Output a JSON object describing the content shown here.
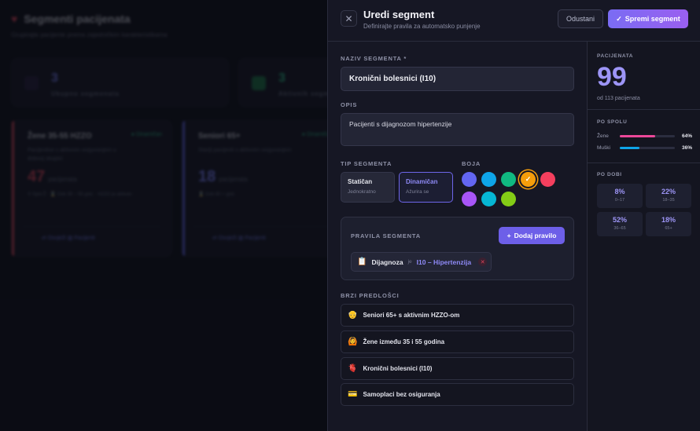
{
  "background": {
    "title": "Segmenti pacijenata",
    "subtitle": "Grupirajte pacijente prema zajedničkim karakteristikama",
    "stats": [
      {
        "value": "3",
        "label": "Ukupno segmenata"
      },
      {
        "value": "3",
        "label": "Aktivnih segmenata"
      }
    ],
    "cards": [
      {
        "title": "Žene 35-55 HZZO",
        "badge": "● Dinamičan",
        "desc": "Pacijentice s aktivnim osiguranjem u dobnoj skupini",
        "count": "47",
        "count_label": "pacijenata",
        "chips": "⚲ Spol Ž · ⌛ Dob 35 – 55 god. · HZZO je aktivan",
        "action": "⇄ Osvježi   ▥ Pacijenti"
      },
      {
        "title": "Seniori 65+",
        "badge": "● Dinamičan",
        "desc": "Stariji pacijenti s aktivnim osiguranjem",
        "count": "18",
        "count_label": "pacijenata",
        "chips": "⌛ Dob 65 + god.",
        "action": "⇄ Osvježi   ▥ Pacijenti"
      }
    ]
  },
  "dialog": {
    "title": "Uredi segment",
    "subtitle": "Definirajte pravila za automatsko punjenje",
    "cancel_label": "Odustani",
    "save_label": "Spremi segment",
    "name_label": "NAZIV SEGMENTA *",
    "name_value": "Kronični bolesnici (I10)",
    "desc_label": "OPIS",
    "desc_value": "Pacijenti s dijagnozom hipertenzije",
    "type_label": "TIP SEGMENTA",
    "types": [
      {
        "name": "Statičan",
        "hint": "Jednokratno",
        "selected": false
      },
      {
        "name": "Dinamičan",
        "hint": "Ažurira se",
        "selected": true
      }
    ],
    "color_label": "BOJA",
    "colors": [
      "#6366f1",
      "#0ea5e9",
      "#10b981",
      "#f59e0b",
      "#f43f5e",
      "#a855f7",
      "#06b6d4",
      "#84cc16"
    ],
    "selected_color_index": 3,
    "rules_label": "PRAVILA SEGMENTA",
    "add_rule_label": "Dodaj pravilo",
    "rule": {
      "field": "Dijagnoza",
      "operator": "je",
      "value": "I10 – Hipertenzija"
    },
    "quick_label": "BRZI PREDLOŠCI",
    "quick_templates": [
      {
        "icon": "👴",
        "label": "Seniori 65+ s aktivnim HZZO-om"
      },
      {
        "icon": "🙆",
        "label": "Žene između 35 i 55 godina"
      },
      {
        "icon": "🫀",
        "label": "Kronični bolesnici (I10)"
      },
      {
        "icon": "💳",
        "label": "Samoplaci bez osiguranja"
      }
    ]
  },
  "preview": {
    "patients_label": "PACIJENATA",
    "count": "99",
    "of_total": "od 113 pacijenata",
    "gender_label": "PO SPOLU",
    "gender": [
      {
        "name": "Žene",
        "percent": "64%",
        "fraction": 0.64,
        "color": "#ec4899"
      },
      {
        "name": "Muški",
        "percent": "36%",
        "fraction": 0.36,
        "color": "#0ea5e9"
      }
    ],
    "age_label": "PO DOBI",
    "age_groups": [
      {
        "value": "8%",
        "range": "0–17"
      },
      {
        "value": "22%",
        "range": "18–35"
      },
      {
        "value": "52%",
        "range": "36–65"
      },
      {
        "value": "18%",
        "range": "65+"
      }
    ]
  }
}
